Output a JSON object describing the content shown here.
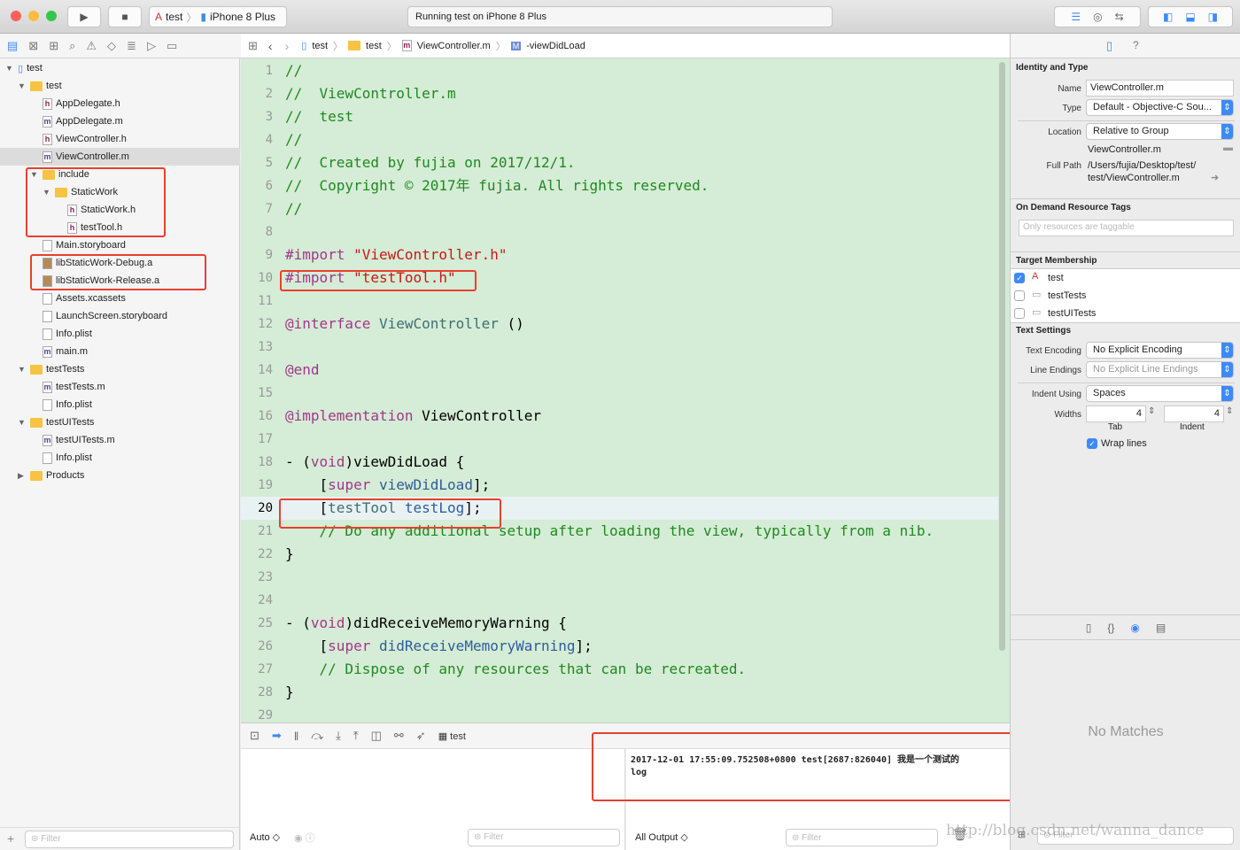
{
  "toolbar": {
    "scheme": "test",
    "device": "iPhone 8 Plus",
    "status": "Running test on iPhone 8 Plus"
  },
  "jumpbar": [
    "test",
    "test",
    "ViewController.m",
    "-viewDidLoad"
  ],
  "navigator": {
    "items": [
      {
        "label": "test",
        "depth": 0,
        "type": "project",
        "open": true
      },
      {
        "label": "test",
        "depth": 1,
        "type": "folder",
        "open": true
      },
      {
        "label": "AppDelegate.h",
        "depth": 2,
        "type": "h"
      },
      {
        "label": "AppDelegate.m",
        "depth": 2,
        "type": "m"
      },
      {
        "label": "ViewController.h",
        "depth": 2,
        "type": "h"
      },
      {
        "label": "ViewController.m",
        "depth": 2,
        "type": "m",
        "selected": true
      },
      {
        "label": "include",
        "depth": 2,
        "type": "folder",
        "open": true
      },
      {
        "label": "StaticWork",
        "depth": 3,
        "type": "folder",
        "open": true
      },
      {
        "label": "StaticWork.h",
        "depth": 4,
        "type": "h"
      },
      {
        "label": "testTool.h",
        "depth": 4,
        "type": "h"
      },
      {
        "label": "Main.storyboard",
        "depth": 2,
        "type": "sb"
      },
      {
        "label": "libStaticWork-Debug.a",
        "depth": 2,
        "type": "lib"
      },
      {
        "label": "libStaticWork-Release.a",
        "depth": 2,
        "type": "lib"
      },
      {
        "label": "Assets.xcassets",
        "depth": 2,
        "type": "asset"
      },
      {
        "label": "LaunchScreen.storyboard",
        "depth": 2,
        "type": "sb"
      },
      {
        "label": "Info.plist",
        "depth": 2,
        "type": "plist"
      },
      {
        "label": "main.m",
        "depth": 2,
        "type": "m"
      },
      {
        "label": "testTests",
        "depth": 1,
        "type": "folder",
        "open": true
      },
      {
        "label": "testTests.m",
        "depth": 2,
        "type": "m"
      },
      {
        "label": "Info.plist",
        "depth": 2,
        "type": "plist"
      },
      {
        "label": "testUITests",
        "depth": 1,
        "type": "folder",
        "open": true
      },
      {
        "label": "testUITests.m",
        "depth": 2,
        "type": "m"
      },
      {
        "label": "Info.plist",
        "depth": 2,
        "type": "plist"
      },
      {
        "label": "Products",
        "depth": 1,
        "type": "folder",
        "open": false
      }
    ],
    "filter_placeholder": "Filter"
  },
  "editor": {
    "current_line": 20,
    "lines": [
      [
        [
          "//",
          "c"
        ]
      ],
      [
        [
          "//  ViewController.m",
          "c"
        ]
      ],
      [
        [
          "//  test",
          "c"
        ]
      ],
      [
        [
          "//",
          "c"
        ]
      ],
      [
        [
          "//  Created by fujia on 2017/12/1.",
          "c"
        ]
      ],
      [
        [
          "//  Copyright © 2017年 fujia. All rights reserved.",
          "c"
        ]
      ],
      [
        [
          "//",
          "c"
        ]
      ],
      [],
      [
        [
          "#import ",
          "p"
        ],
        [
          "\"ViewController.h\"",
          "s"
        ]
      ],
      [
        [
          "#import ",
          "p"
        ],
        [
          "\"testTool.h\"",
          "s"
        ]
      ],
      [],
      [
        [
          "@interface ",
          "k"
        ],
        [
          "ViewController",
          "t"
        ],
        [
          " ()",
          "n"
        ]
      ],
      [],
      [
        [
          "@end",
          "k"
        ]
      ],
      [],
      [
        [
          "@implementation ",
          "k"
        ],
        [
          "ViewController",
          "n"
        ]
      ],
      [],
      [
        [
          "- (",
          "n"
        ],
        [
          "void",
          "k"
        ],
        [
          ")viewDidLoad {",
          "n"
        ]
      ],
      [
        [
          "    [",
          "n"
        ],
        [
          "super",
          "k"
        ],
        [
          " ",
          "n"
        ],
        [
          "viewDidLoad",
          "m"
        ],
        [
          "];",
          "n"
        ]
      ],
      [
        [
          "    [",
          "n"
        ],
        [
          "testTool",
          "t"
        ],
        [
          " ",
          "n"
        ],
        [
          "testLog",
          "m"
        ],
        [
          "];",
          "n"
        ]
      ],
      [
        [
          "    // Do any additional setup after loading the view, typically from a nib.",
          "c"
        ]
      ],
      [
        [
          "}",
          "n"
        ]
      ],
      [],
      [],
      [
        [
          "- (",
          "n"
        ],
        [
          "void",
          "k"
        ],
        [
          ")didReceiveMemoryWarning {",
          "n"
        ]
      ],
      [
        [
          "    [",
          "n"
        ],
        [
          "super",
          "k"
        ],
        [
          " ",
          "n"
        ],
        [
          "didReceiveMemoryWarning",
          "m"
        ],
        [
          "];",
          "n"
        ]
      ],
      [
        [
          "    // Dispose of any resources that can be recreated.",
          "c"
        ]
      ],
      [
        [
          "}",
          "n"
        ]
      ],
      []
    ]
  },
  "debug": {
    "process": "test",
    "auto_label": "Auto ◇",
    "output_label": "All Output ◇",
    "filter_placeholder": "Filter",
    "console": [
      "2017-12-01 17:55:09.752508+0800 test[2687:826040] 我是一个测试的",
      "log"
    ]
  },
  "inspector": {
    "identity_header": "Identity and Type",
    "name_label": "Name",
    "name": "ViewController.m",
    "type_label": "Type",
    "type": "Default - Objective-C Sou...",
    "location_label": "Location",
    "location": "Relative to Group",
    "location_file": "ViewController.m",
    "fullpath_label": "Full Path",
    "fullpath": [
      "/Users/fujia/Desktop/test/",
      "test/ViewController.m"
    ],
    "odr_header": "On Demand Resource Tags",
    "odr_placeholder": "Only resources are taggable",
    "target_header": "Target Membership",
    "targets": [
      {
        "label": "test",
        "checked": true
      },
      {
        "label": "testTests",
        "checked": false
      },
      {
        "label": "testUITests",
        "checked": false
      }
    ],
    "text_header": "Text Settings",
    "encoding_label": "Text Encoding",
    "encoding": "No Explicit Encoding",
    "endings_label": "Line Endings",
    "endings": "No Explicit Line Endings",
    "indent_label": "Indent Using",
    "indent": "Spaces",
    "widths_label": "Widths",
    "tab_width": "4",
    "indent_width": "4",
    "tab_label": "Tab",
    "indent_sub_label": "Indent",
    "wrap_label": "Wrap lines",
    "wrap": true,
    "library_empty": "No Matches",
    "library_filter": "Filter"
  },
  "watermark": "http://blog.csdn.net/wanna_dance",
  "colors": {
    "editor_bg": "#d5ecd6",
    "highlight_box": "#e8402f",
    "accent": "#3d8af7"
  }
}
